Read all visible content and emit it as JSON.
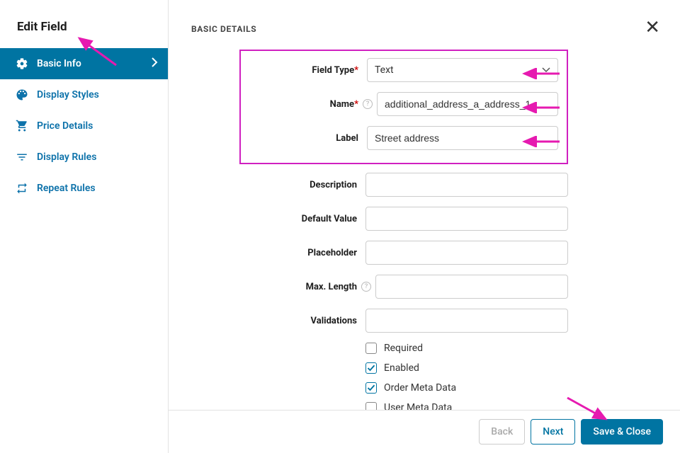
{
  "sidebar": {
    "title": "Edit Field",
    "items": [
      {
        "label": "Basic Info"
      },
      {
        "label": "Display Styles"
      },
      {
        "label": "Price Details"
      },
      {
        "label": "Display Rules"
      },
      {
        "label": "Repeat Rules"
      }
    ]
  },
  "section_title": "BASIC DETAILS",
  "form": {
    "field_type_label": "Field Type",
    "field_type_value": "Text",
    "name_label": "Name",
    "name_value": "additional_address_a_address_1",
    "label_label": "Label",
    "label_value": "Street address",
    "description_label": "Description",
    "description_value": "",
    "default_value_label": "Default Value",
    "default_value_value": "",
    "placeholder_label": "Placeholder",
    "placeholder_value": "",
    "max_length_label": "Max. Length",
    "max_length_value": "",
    "validations_label": "Validations",
    "validations_value": ""
  },
  "checkboxes": {
    "required": "Required",
    "enabled": "Enabled",
    "order_meta": "Order Meta Data",
    "user_meta": "User Meta Data"
  },
  "footer": {
    "back": "Back",
    "next": "Next",
    "save": "Save & Close"
  }
}
